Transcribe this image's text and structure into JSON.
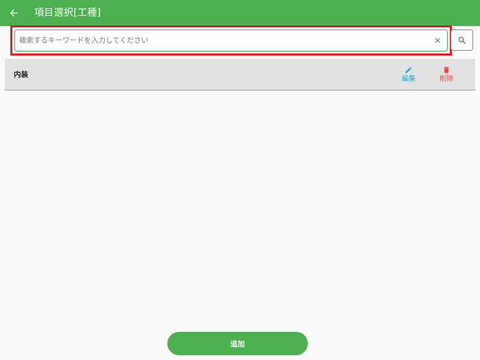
{
  "app_bar": {
    "title": "項目選択[工種]",
    "back_icon": "arrow-left-icon",
    "color": "#4caf50"
  },
  "search": {
    "value": "",
    "placeholder": "検索するキーワードを入力してください",
    "clear_icon": "close-icon",
    "search_icon": "search-icon",
    "highlight_color": "#e11d2b"
  },
  "list": {
    "items": [
      {
        "label": "内装",
        "edit_label": "編集",
        "delete_label": "削除"
      }
    ]
  },
  "footer": {
    "add_label": "追加"
  },
  "colors": {
    "accent": "#4caf50",
    "edit": "#29a8c9",
    "delete": "#ee4b4b"
  }
}
